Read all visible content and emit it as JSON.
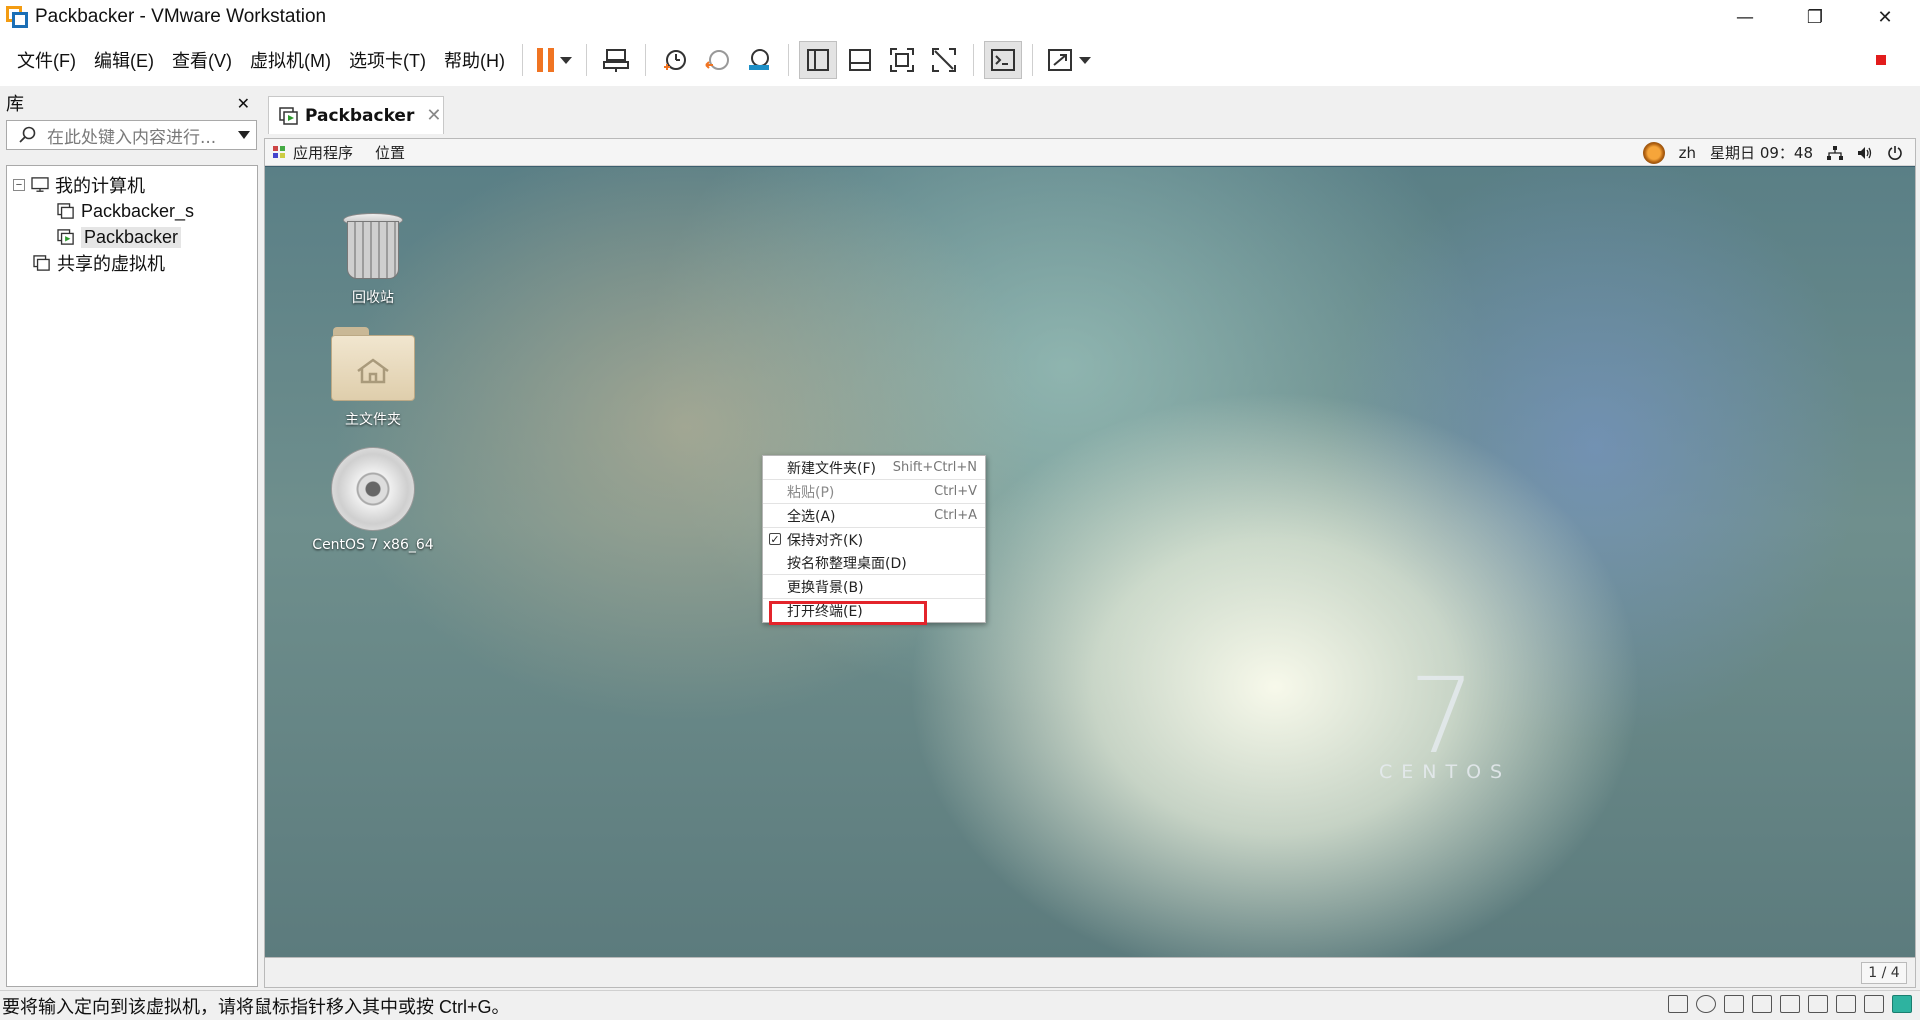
{
  "window": {
    "title": "Packbacker - VMware Workstation",
    "controls": {
      "minimize": "—",
      "restore": "❐",
      "close": "✕"
    }
  },
  "menu": {
    "items": [
      {
        "label": "文件(F)"
      },
      {
        "label": "编辑(E)"
      },
      {
        "label": "查看(V)"
      },
      {
        "label": "虚拟机(M)"
      },
      {
        "label": "选项卡(T)"
      },
      {
        "label": "帮助(H)"
      }
    ]
  },
  "toolbar": {
    "icons": [
      "pause-icon",
      "send-ctrl-alt-del-icon",
      "snapshot-take-icon",
      "snapshot-revert-icon",
      "snapshot-manager-icon",
      "library-view-icon",
      "thumbnail-view-icon",
      "full-screen-icon",
      "unity-icon",
      "console-icon",
      "stretch-icon"
    ],
    "accent": "#f07422"
  },
  "library": {
    "title": "库",
    "close_label": "✕",
    "search_placeholder": "在此处键入内容进行...",
    "tree": {
      "root": "我的计算机",
      "toggle": "−",
      "children": [
        "Packbacker_s",
        "Packbacker"
      ],
      "shared": "共享的虚拟机"
    }
  },
  "tab": {
    "label": "Packbacker",
    "close": "✕"
  },
  "guest": {
    "topbar": {
      "apps": "应用程序",
      "places": "位置",
      "lang": "zh",
      "clock": "星期日 09：48"
    },
    "desktop_icons": [
      {
        "label": "回收站"
      },
      {
        "label": "主文件夹"
      },
      {
        "label": "CentOS 7 x86_64"
      }
    ],
    "context_menu": [
      {
        "label": "新建文件夹(F)",
        "shortcut": "Shift+Ctrl+N"
      },
      {
        "label": "粘贴(P)",
        "shortcut": "Ctrl+V",
        "disabled": true
      },
      {
        "label": "全选(A)",
        "shortcut": "Ctrl+A"
      },
      {
        "label": "保持对齐(K)",
        "shortcut": "",
        "checked": true
      },
      {
        "label": "按名称整理桌面(D)",
        "shortcut": ""
      },
      {
        "label": "更换背景(B)",
        "shortcut": ""
      },
      {
        "label": "打开终端(E)",
        "shortcut": ""
      }
    ],
    "check_mark": "✓",
    "watermark": {
      "number": "7",
      "word": "CENTOS"
    }
  },
  "pager": "1 / 4",
  "status": {
    "message": "要将输入定向到该虚拟机，请将鼠标指针移入其中或按 Ctrl+G。"
  },
  "colors": {
    "highlight": "#e3242b",
    "record_indicator": "#e21c1c"
  }
}
